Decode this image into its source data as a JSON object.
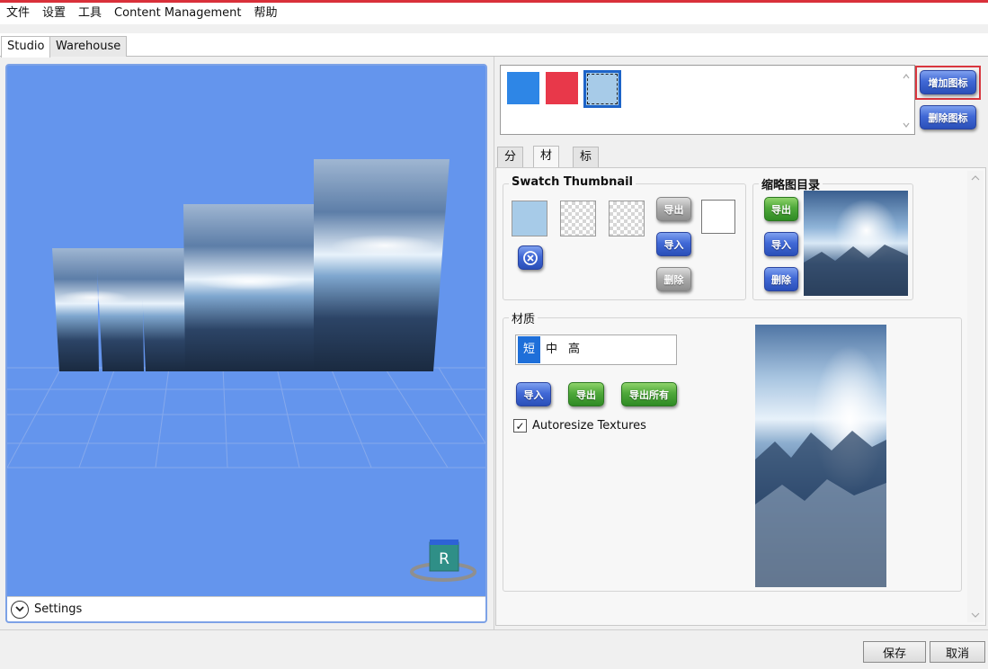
{
  "menu": [
    "文件",
    "设置",
    "工具",
    "Content Management",
    "帮助"
  ],
  "tabs": [
    "Studio",
    "Warehouse"
  ],
  "viewport": {
    "settings_label": "Settings",
    "nav_cube_letter": "R"
  },
  "icons": {
    "swatches": [
      "#2e86e6",
      "#e8384a",
      "#a7cbe8"
    ],
    "add_button": "增加图标",
    "delete_button": "删除图标"
  },
  "subtabs": [
    "分类",
    "材质",
    "标签"
  ],
  "swatch_thumbnail": {
    "title": "Swatch Thumbnail",
    "export_button": "导出",
    "import_button": "导入",
    "delete_button": "删除"
  },
  "thumbnail_dir": {
    "title": "缩略图目录",
    "export_button": "导出",
    "import_button": "导入",
    "delete_button": "删除"
  },
  "material": {
    "title": "材质",
    "lod": [
      "短",
      "中",
      "高"
    ],
    "import_button": "导入",
    "export_button": "导出",
    "export_all_button": "导出所有",
    "autoresize_label": "Autoresize Textures",
    "autoresize_checked": true
  },
  "footer": {
    "save_button": "保存",
    "cancel_button": "取消"
  }
}
